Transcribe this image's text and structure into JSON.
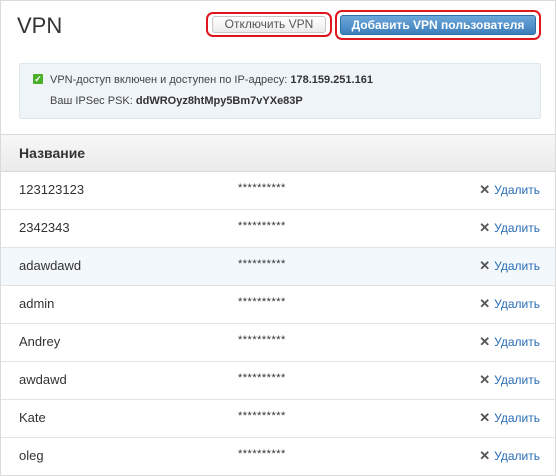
{
  "header": {
    "title": "VPN",
    "disable_label": "Отключить VPN",
    "add_label": "Добавить VPN пользователя"
  },
  "info": {
    "line1_prefix": "VPN-доступ включен и доступен по IP-адресу:",
    "ip": "178.159.251.161",
    "line2_prefix": "Ваш IPSec PSK:",
    "psk": "ddWROyz8htMpy5Bm7vYXe83P"
  },
  "table": {
    "header": "Название",
    "delete_label": "Удалить",
    "rows": [
      {
        "name": "123123123",
        "password": "**********"
      },
      {
        "name": "2342343",
        "password": "**********"
      },
      {
        "name": "adawdawd",
        "password": "**********"
      },
      {
        "name": "admin",
        "password": "**********"
      },
      {
        "name": "Andrey",
        "password": "**********"
      },
      {
        "name": "awdawd",
        "password": "**********"
      },
      {
        "name": "Kate",
        "password": "**********"
      },
      {
        "name": "oleg",
        "password": "**********"
      }
    ]
  },
  "colors": {
    "accent": "#3d7fbd",
    "highlight_border": "#e0161e",
    "link": "#2a6db5",
    "info_bg": "#eef4f8",
    "status_ok": "#4caf2a"
  },
  "icons": {
    "info": "check-icon",
    "delete": "close-icon"
  }
}
